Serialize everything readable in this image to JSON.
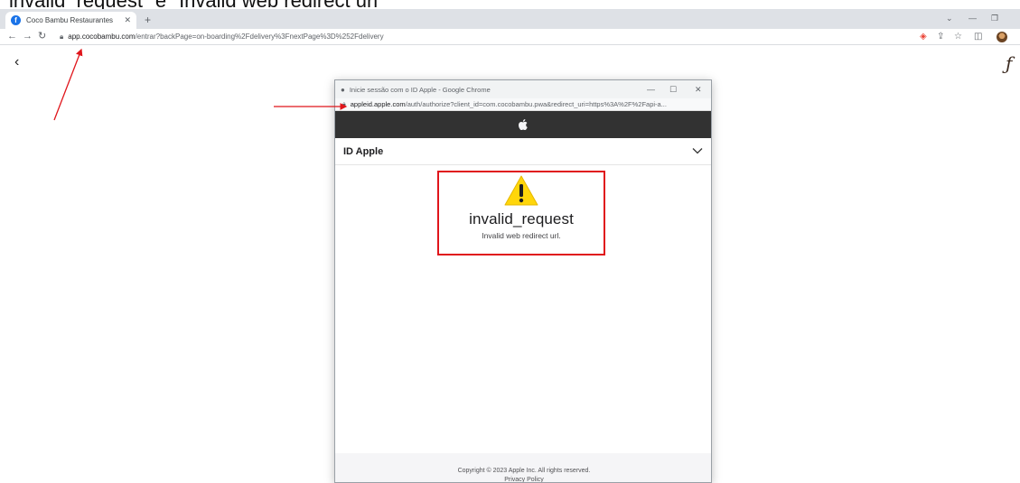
{
  "caption": "invalid_request\" e \"Invalid web redirect url\"",
  "browser": {
    "tab": {
      "title": "Coco Bambu Restaurantes",
      "close": "✕",
      "favicon": "coco-bambu-favicon"
    },
    "new_tab": "+",
    "window_controls": {
      "min": "—",
      "restore": "❐",
      "chevron": "⌄"
    },
    "url": {
      "host": "app.cocobambu.com",
      "path": "/entrar?backPage=on-boarding%2Fdelivery%3FnextPage%3D%252Fdelivery"
    },
    "toolbar_icons": [
      "google-lens-icon",
      "share-icon",
      "star-icon",
      "sidepanel-icon",
      "profile-avatar"
    ]
  },
  "page": {
    "back": "‹",
    "logo_glyph": "ƒ"
  },
  "popup": {
    "title": "Inicie sessão com o ID Apple - Google Chrome",
    "controls": {
      "min": "—",
      "max": "☐",
      "close": "✕"
    },
    "url": {
      "host": "appleid.apple.com",
      "path": "/auth/authorize?client_id=com.cocobambu.pwa&redirect_uri=https%3A%2F%2Fapi-a..."
    },
    "header_title": "ID Apple",
    "error": {
      "title": "invalid_request",
      "description": "Invalid web redirect url."
    },
    "footer": {
      "copyright": "Copyright © 2023 Apple Inc. All rights reserved.",
      "privacy": "Privacy Policy"
    }
  },
  "colors": {
    "annotation_red": "#e0151b",
    "apple_bar": "#323232",
    "warning_yellow": "#ffd60a"
  }
}
